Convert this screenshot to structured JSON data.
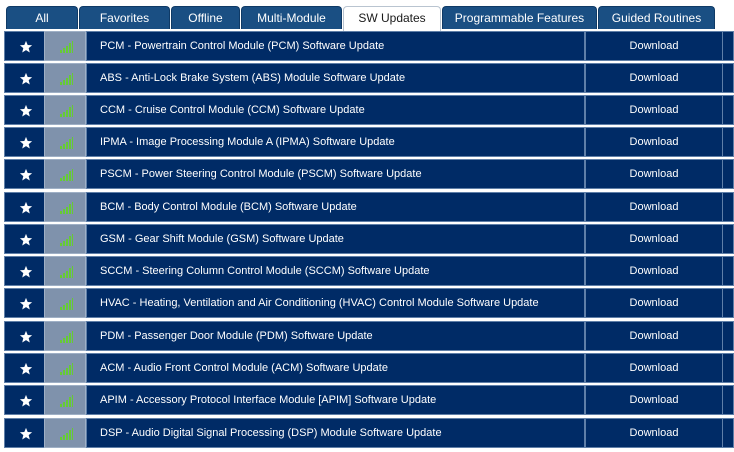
{
  "tabs": [
    {
      "label": "All",
      "active": false
    },
    {
      "label": "Favorites",
      "active": false
    },
    {
      "label": "Offline",
      "active": false
    },
    {
      "label": "Multi-Module",
      "active": false
    },
    {
      "label": "SW Updates",
      "active": true
    },
    {
      "label": "Programmable Features",
      "active": false
    },
    {
      "label": "Guided Routines",
      "active": false
    }
  ],
  "rows": [
    {
      "name": "PCM - Powertrain Control Module (PCM) Software Update",
      "action": "Download"
    },
    {
      "name": "ABS - Anti-Lock Brake System (ABS) Module Software Update",
      "action": "Download"
    },
    {
      "name": "CCM - Cruise Control Module (CCM) Software Update",
      "action": "Download"
    },
    {
      "name": "IPMA - Image Processing Module A (IPMA) Software Update",
      "action": "Download"
    },
    {
      "name": "PSCM - Power Steering Control Module (PSCM) Software Update",
      "action": "Download"
    },
    {
      "name": "BCM - Body Control Module (BCM) Software Update",
      "action": "Download"
    },
    {
      "name": "GSM - Gear Shift Module (GSM) Software Update",
      "action": "Download"
    },
    {
      "name": "SCCM - Steering Column Control Module (SCCM) Software Update",
      "action": "Download"
    },
    {
      "name": "HVAC - Heating, Ventilation and Air Conditioning (HVAC) Control Module Software Update",
      "action": "Download"
    },
    {
      "name": "PDM - Passenger Door Module (PDM) Software Update",
      "action": "Download"
    },
    {
      "name": "ACM - Audio Front Control Module (ACM) Software Update",
      "action": "Download"
    },
    {
      "name": "APIM - Accessory Protocol Interface Module [APIM] Software Update",
      "action": "Download"
    },
    {
      "name": "DSP - Audio Digital Signal Processing (DSP) Module Software Update",
      "action": "Download"
    }
  ],
  "icons": {
    "favorite": "star-icon",
    "signal": "signal-strength-icon"
  },
  "colors": {
    "tab_bg": "#1a4f83",
    "row_bg": "#002b66",
    "signal_cell_bg": "#7f92ac",
    "signal_bars": "#66cc33",
    "star": "#ffffff"
  }
}
